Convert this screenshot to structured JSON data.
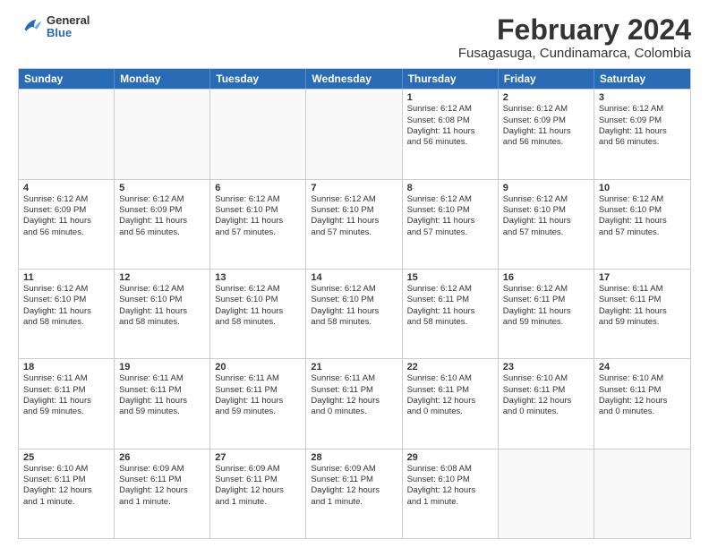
{
  "logo": {
    "general": "General",
    "blue": "Blue"
  },
  "header": {
    "month": "February 2024",
    "location": "Fusagasuga, Cundinamarca, Colombia"
  },
  "days": [
    "Sunday",
    "Monday",
    "Tuesday",
    "Wednesday",
    "Thursday",
    "Friday",
    "Saturday"
  ],
  "weeks": [
    [
      {
        "day": "",
        "empty": true
      },
      {
        "day": "",
        "empty": true
      },
      {
        "day": "",
        "empty": true
      },
      {
        "day": "",
        "empty": true
      },
      {
        "day": "1",
        "lines": [
          "Sunrise: 6:12 AM",
          "Sunset: 6:08 PM",
          "Daylight: 11 hours",
          "and 56 minutes."
        ]
      },
      {
        "day": "2",
        "lines": [
          "Sunrise: 6:12 AM",
          "Sunset: 6:09 PM",
          "Daylight: 11 hours",
          "and 56 minutes."
        ]
      },
      {
        "day": "3",
        "lines": [
          "Sunrise: 6:12 AM",
          "Sunset: 6:09 PM",
          "Daylight: 11 hours",
          "and 56 minutes."
        ]
      }
    ],
    [
      {
        "day": "4",
        "lines": [
          "Sunrise: 6:12 AM",
          "Sunset: 6:09 PM",
          "Daylight: 11 hours",
          "and 56 minutes."
        ]
      },
      {
        "day": "5",
        "lines": [
          "Sunrise: 6:12 AM",
          "Sunset: 6:09 PM",
          "Daylight: 11 hours",
          "and 56 minutes."
        ]
      },
      {
        "day": "6",
        "lines": [
          "Sunrise: 6:12 AM",
          "Sunset: 6:10 PM",
          "Daylight: 11 hours",
          "and 57 minutes."
        ]
      },
      {
        "day": "7",
        "lines": [
          "Sunrise: 6:12 AM",
          "Sunset: 6:10 PM",
          "Daylight: 11 hours",
          "and 57 minutes."
        ]
      },
      {
        "day": "8",
        "lines": [
          "Sunrise: 6:12 AM",
          "Sunset: 6:10 PM",
          "Daylight: 11 hours",
          "and 57 minutes."
        ]
      },
      {
        "day": "9",
        "lines": [
          "Sunrise: 6:12 AM",
          "Sunset: 6:10 PM",
          "Daylight: 11 hours",
          "and 57 minutes."
        ]
      },
      {
        "day": "10",
        "lines": [
          "Sunrise: 6:12 AM",
          "Sunset: 6:10 PM",
          "Daylight: 11 hours",
          "and 57 minutes."
        ]
      }
    ],
    [
      {
        "day": "11",
        "lines": [
          "Sunrise: 6:12 AM",
          "Sunset: 6:10 PM",
          "Daylight: 11 hours",
          "and 58 minutes."
        ]
      },
      {
        "day": "12",
        "lines": [
          "Sunrise: 6:12 AM",
          "Sunset: 6:10 PM",
          "Daylight: 11 hours",
          "and 58 minutes."
        ]
      },
      {
        "day": "13",
        "lines": [
          "Sunrise: 6:12 AM",
          "Sunset: 6:10 PM",
          "Daylight: 11 hours",
          "and 58 minutes."
        ]
      },
      {
        "day": "14",
        "lines": [
          "Sunrise: 6:12 AM",
          "Sunset: 6:10 PM",
          "Daylight: 11 hours",
          "and 58 minutes."
        ]
      },
      {
        "day": "15",
        "lines": [
          "Sunrise: 6:12 AM",
          "Sunset: 6:11 PM",
          "Daylight: 11 hours",
          "and 58 minutes."
        ]
      },
      {
        "day": "16",
        "lines": [
          "Sunrise: 6:12 AM",
          "Sunset: 6:11 PM",
          "Daylight: 11 hours",
          "and 59 minutes."
        ]
      },
      {
        "day": "17",
        "lines": [
          "Sunrise: 6:11 AM",
          "Sunset: 6:11 PM",
          "Daylight: 11 hours",
          "and 59 minutes."
        ]
      }
    ],
    [
      {
        "day": "18",
        "lines": [
          "Sunrise: 6:11 AM",
          "Sunset: 6:11 PM",
          "Daylight: 11 hours",
          "and 59 minutes."
        ]
      },
      {
        "day": "19",
        "lines": [
          "Sunrise: 6:11 AM",
          "Sunset: 6:11 PM",
          "Daylight: 11 hours",
          "and 59 minutes."
        ]
      },
      {
        "day": "20",
        "lines": [
          "Sunrise: 6:11 AM",
          "Sunset: 6:11 PM",
          "Daylight: 11 hours",
          "and 59 minutes."
        ]
      },
      {
        "day": "21",
        "lines": [
          "Sunrise: 6:11 AM",
          "Sunset: 6:11 PM",
          "Daylight: 12 hours",
          "and 0 minutes."
        ]
      },
      {
        "day": "22",
        "lines": [
          "Sunrise: 6:10 AM",
          "Sunset: 6:11 PM",
          "Daylight: 12 hours",
          "and 0 minutes."
        ]
      },
      {
        "day": "23",
        "lines": [
          "Sunrise: 6:10 AM",
          "Sunset: 6:11 PM",
          "Daylight: 12 hours",
          "and 0 minutes."
        ]
      },
      {
        "day": "24",
        "lines": [
          "Sunrise: 6:10 AM",
          "Sunset: 6:11 PM",
          "Daylight: 12 hours",
          "and 0 minutes."
        ]
      }
    ],
    [
      {
        "day": "25",
        "lines": [
          "Sunrise: 6:10 AM",
          "Sunset: 6:11 PM",
          "Daylight: 12 hours",
          "and 1 minute."
        ]
      },
      {
        "day": "26",
        "lines": [
          "Sunrise: 6:09 AM",
          "Sunset: 6:11 PM",
          "Daylight: 12 hours",
          "and 1 minute."
        ]
      },
      {
        "day": "27",
        "lines": [
          "Sunrise: 6:09 AM",
          "Sunset: 6:11 PM",
          "Daylight: 12 hours",
          "and 1 minute."
        ]
      },
      {
        "day": "28",
        "lines": [
          "Sunrise: 6:09 AM",
          "Sunset: 6:11 PM",
          "Daylight: 12 hours",
          "and 1 minute."
        ]
      },
      {
        "day": "29",
        "lines": [
          "Sunrise: 6:08 AM",
          "Sunset: 6:10 PM",
          "Daylight: 12 hours",
          "and 1 minute."
        ]
      },
      {
        "day": "",
        "empty": true
      },
      {
        "day": "",
        "empty": true
      }
    ]
  ]
}
